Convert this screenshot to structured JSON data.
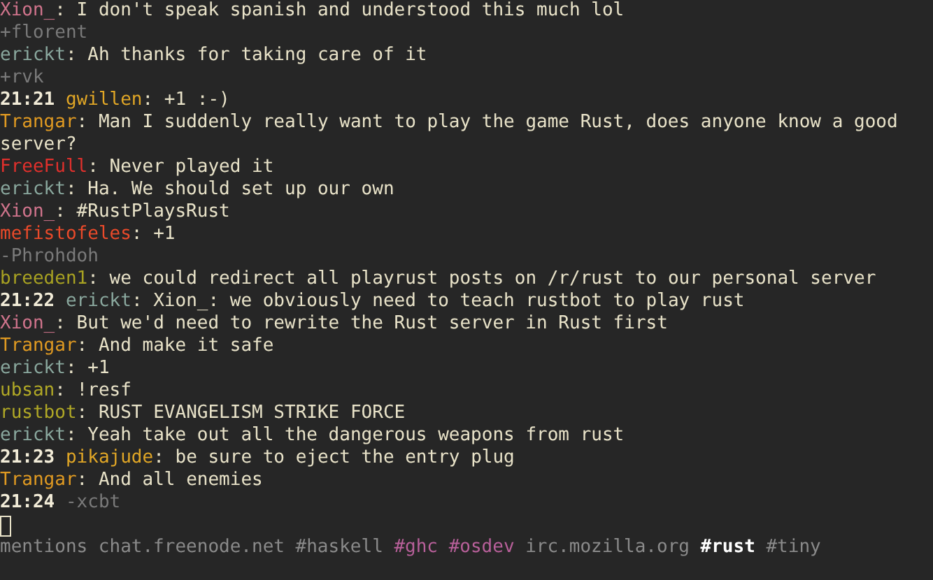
{
  "messages": [
    {
      "kind": "message",
      "nick": "Xion_",
      "color": "#d0748c",
      "text": ": I don't speak spanish and understood this much lol"
    },
    {
      "kind": "join",
      "text": "+florent"
    },
    {
      "kind": "message",
      "nick": "erickt",
      "color": "#8aa89e",
      "text": ": Ah thanks for taking care of it"
    },
    {
      "kind": "join",
      "text": "+rvk"
    },
    {
      "kind": "message",
      "time": "21:21",
      "nick": "gwillen",
      "color": "#e0a626",
      "text": ": +1 :-)"
    },
    {
      "kind": "message",
      "nick": "Trangar",
      "color": "#e09a22",
      "text": ": Man I suddenly really want to play the game Rust, does anyone know a good"
    },
    {
      "kind": "continuation",
      "text": "server?"
    },
    {
      "kind": "message",
      "nick": "FreeFull",
      "color": "#e0302c",
      "text": ": Never played it"
    },
    {
      "kind": "message",
      "nick": "erickt",
      "color": "#8aa89e",
      "text": ": Ha. We should set up our own"
    },
    {
      "kind": "message",
      "nick": "Xion_",
      "color": "#d0748c",
      "text": ": #RustPlaysRust"
    },
    {
      "kind": "message",
      "nick": "mefistofeles",
      "color": "#ea4a2a",
      "text": ": +1"
    },
    {
      "kind": "quit",
      "text": "-Phrohdoh"
    },
    {
      "kind": "message",
      "nick": "breeden1",
      "color": "#a8a222",
      "text": ": we could redirect all playrust posts on /r/rust to our personal server"
    },
    {
      "kind": "message",
      "time": "21:22",
      "nick": "erickt",
      "color": "#8aa89e",
      "text": ": Xion_: we obviously need to teach rustbot to play rust"
    },
    {
      "kind": "message",
      "nick": "Xion_",
      "color": "#d0748c",
      "text": ": But we'd need to rewrite the Rust server in Rust first"
    },
    {
      "kind": "message",
      "nick": "Trangar",
      "color": "#e09a22",
      "text": ": And make it safe"
    },
    {
      "kind": "message",
      "nick": "erickt",
      "color": "#8aa89e",
      "text": ": +1"
    },
    {
      "kind": "message",
      "nick": "ubsan",
      "color": "#b0a826",
      "text": ": !resf"
    },
    {
      "kind": "message",
      "nick": "rustbot",
      "color": "#b0a826",
      "text": ": RUST EVANGELISM STRIKE FORCE"
    },
    {
      "kind": "message",
      "nick": "erickt",
      "color": "#8aa89e",
      "text": ": Yeah take out all the dangerous weapons from rust"
    },
    {
      "kind": "message",
      "time": "21:23",
      "nick": "pikajude",
      "color": "#e0a626",
      "text": ": be sure to eject the entry plug"
    },
    {
      "kind": "message",
      "nick": "Trangar",
      "color": "#e09a22",
      "text": ": And all enemies"
    },
    {
      "kind": "quit",
      "time": "21:24",
      "text": "-xcbt"
    }
  ],
  "tabs": [
    {
      "label": "mentions",
      "color": "#8a8a8a",
      "selected": false
    },
    {
      "label": "chat.freenode.net",
      "color": "#8a8a8a",
      "selected": false
    },
    {
      "label": "#haskell",
      "color": "#8a8a8a",
      "selected": false
    },
    {
      "label": "#ghc",
      "color": "#b8609a",
      "selected": false
    },
    {
      "label": "#osdev",
      "color": "#b8609a",
      "selected": false
    },
    {
      "label": "irc.mozilla.org",
      "color": "#8a8a8a",
      "selected": false
    },
    {
      "label": "#rust",
      "color": "#ffffff",
      "selected": true
    },
    {
      "label": "#tiny",
      "color": "#8a8a8a",
      "selected": false
    }
  ]
}
